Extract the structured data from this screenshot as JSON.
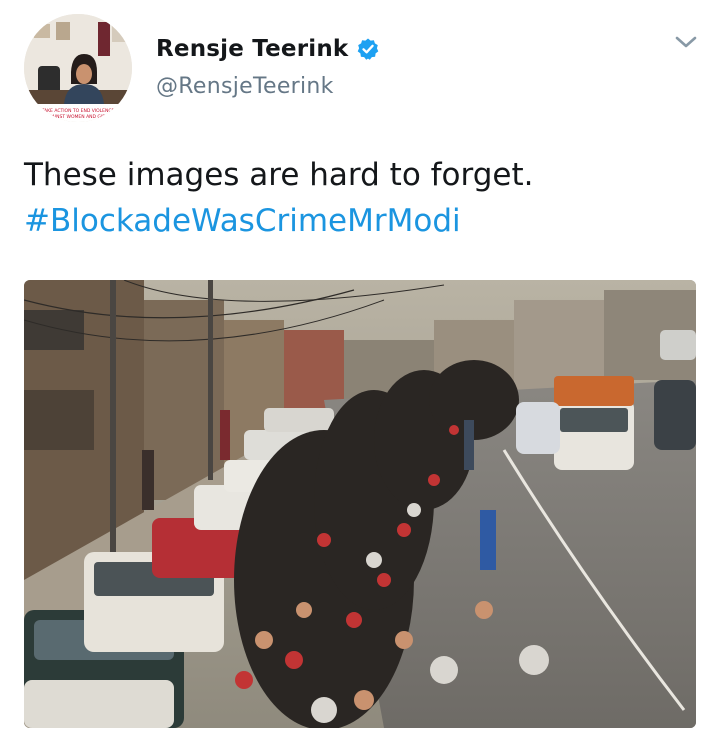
{
  "user": {
    "display_name": "Rensje Teerink",
    "handle": "@RensjeTeerink",
    "verified": true,
    "avatar_caption": "TAKE ACTION TO END VIOLENCE AGAINST WOMEN AND GIRLS"
  },
  "tweet": {
    "text": "These images are hard to forget.",
    "hashtag": "#BlockadeWasCrimeMrModi"
  },
  "media": {
    "alt": "Long queue of motorcycles and cars on a city street"
  },
  "icons": {
    "verified": "verified-badge-icon",
    "menu": "chevron-down-icon"
  },
  "colors": {
    "link": "#1b95e0",
    "handle": "#657786",
    "verified": "#1da1f2",
    "caret": "#8899a6"
  }
}
